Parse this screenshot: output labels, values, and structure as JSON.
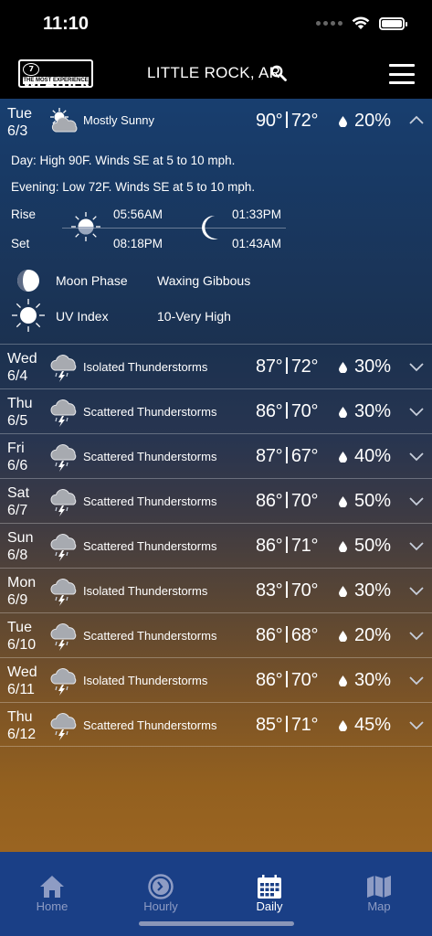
{
  "status_bar": {
    "time": "11:10"
  },
  "header": {
    "logo_text": "7WEATHER",
    "logo_number": "7",
    "logo_subtitle": "THE MOST EXPERIENCE",
    "location": "LITTLE ROCK, AR"
  },
  "today": {
    "day": "Tue",
    "date": "6/3",
    "condition": "Mostly Sunny",
    "high": "90°",
    "low": "72°",
    "precip": "20%",
    "day_detail": "Day: High 90F. Winds SE at 5 to 10 mph.",
    "evening_detail": "Evening:  Low 72F. Winds SE at 5 to 10 mph.",
    "rise_label": "Rise",
    "set_label": "Set",
    "sunrise": "05:56AM",
    "sunset": "08:18PM",
    "moonrise": "01:33PM",
    "moonset": "01:43AM",
    "moon_phase_label": "Moon Phase",
    "moon_phase_value": "Waxing Gibbous",
    "uv_label": "UV Index",
    "uv_value": "10-Very High"
  },
  "forecast": [
    {
      "day": "Wed",
      "date": "6/4",
      "condition": "Isolated Thunderstorms",
      "high": "87°",
      "low": "72°",
      "precip": "30%"
    },
    {
      "day": "Thu",
      "date": "6/5",
      "condition": "Scattered Thunderstorms",
      "high": "86°",
      "low": "70°",
      "precip": "30%"
    },
    {
      "day": "Fri",
      "date": "6/6",
      "condition": "Scattered Thunderstorms",
      "high": "87°",
      "low": "67°",
      "precip": "40%"
    },
    {
      "day": "Sat",
      "date": "6/7",
      "condition": "Scattered Thunderstorms",
      "high": "86°",
      "low": "70°",
      "precip": "50%"
    },
    {
      "day": "Sun",
      "date": "6/8",
      "condition": "Scattered Thunderstorms",
      "high": "86°",
      "low": "71°",
      "precip": "50%"
    },
    {
      "day": "Mon",
      "date": "6/9",
      "condition": "Isolated Thunderstorms",
      "high": "83°",
      "low": "70°",
      "precip": "30%"
    },
    {
      "day": "Tue",
      "date": "6/10",
      "condition": "Scattered Thunderstorms",
      "high": "86°",
      "low": "68°",
      "precip": "20%"
    },
    {
      "day": "Wed",
      "date": "6/11",
      "condition": "Isolated Thunderstorms",
      "high": "86°",
      "low": "70°",
      "precip": "30%"
    },
    {
      "day": "Thu",
      "date": "6/12",
      "condition": "Scattered Thunderstorms",
      "high": "85°",
      "low": "71°",
      "precip": "45%"
    }
  ],
  "tabs": [
    {
      "label": "Home",
      "icon": "home-icon"
    },
    {
      "label": "Hourly",
      "icon": "clock-icon"
    },
    {
      "label": "Daily",
      "icon": "calendar-icon",
      "active": true
    },
    {
      "label": "Map",
      "icon": "map-icon"
    }
  ],
  "colors": {
    "tab_bar": "#1a3f86",
    "tab_inactive": "#8e9cc4",
    "tab_active": "#ffffff"
  }
}
